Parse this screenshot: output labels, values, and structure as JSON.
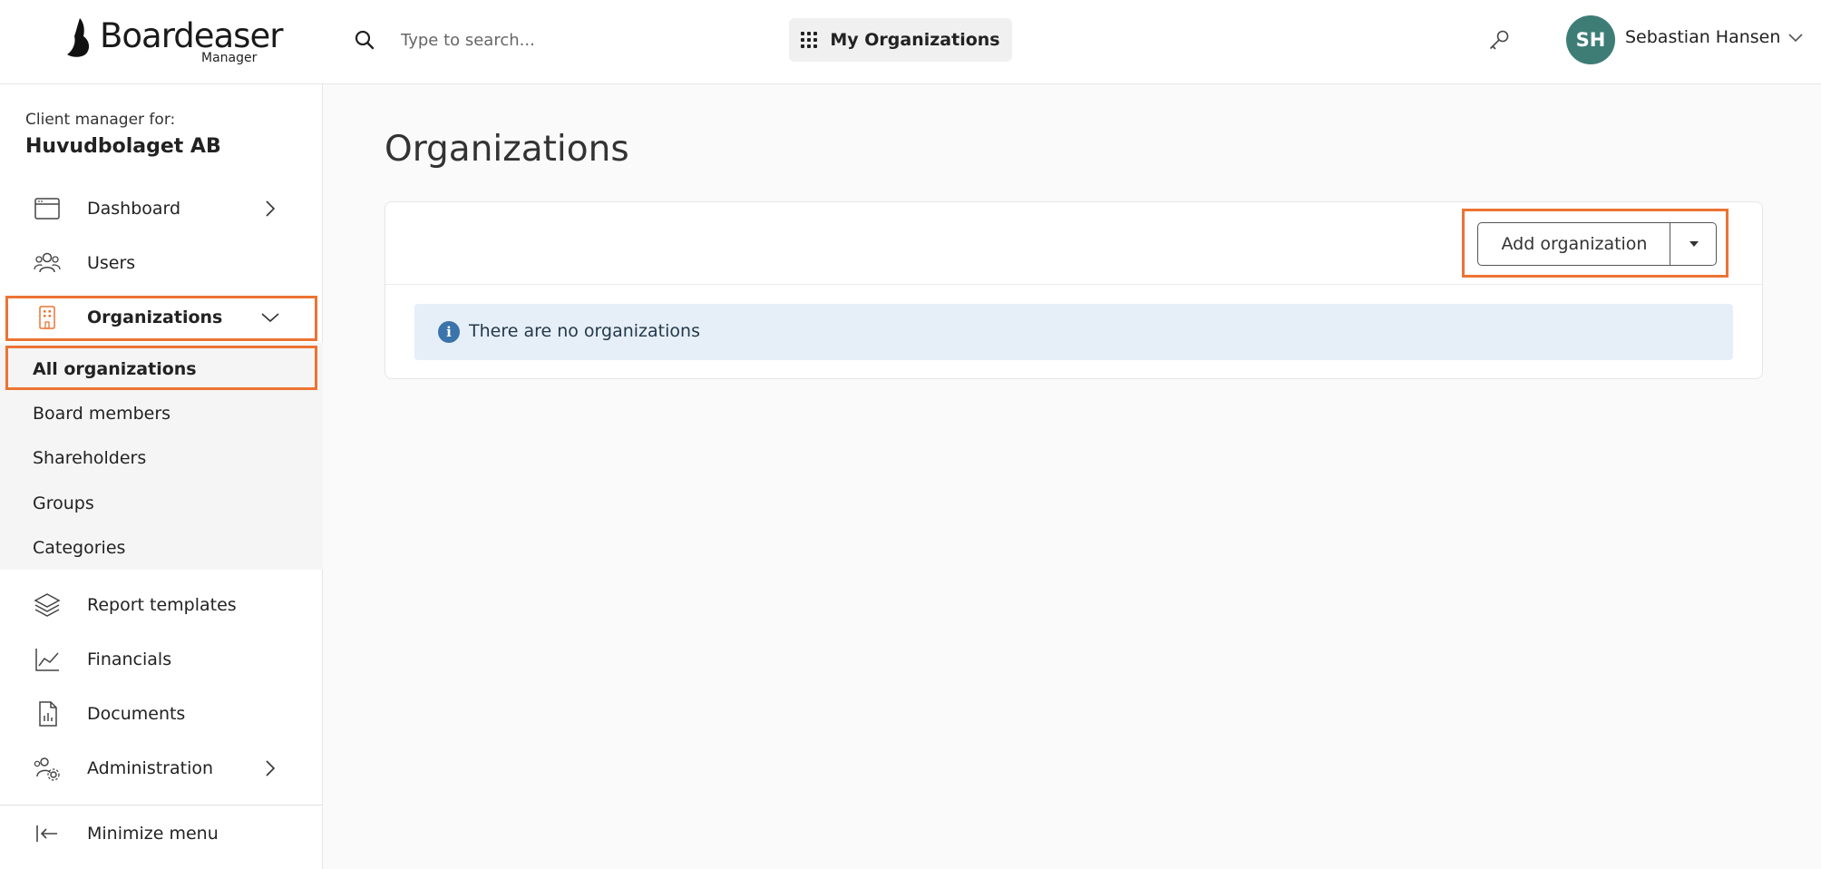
{
  "header": {
    "brand": "Boardeaser",
    "brand_sub": "Manager",
    "search_placeholder": "Type to search...",
    "org_switcher_label": "My Organizations",
    "user_initials": "SH",
    "user_name": "Sebastian Hansen",
    "avatar_color": "#3d7d76"
  },
  "sidebar": {
    "client_label": "Client manager for:",
    "client_name": "Huvudbolaget AB",
    "items": [
      {
        "label": "Dashboard",
        "icon": "browser-window-icon",
        "has_chevron": true
      },
      {
        "label": "Users",
        "icon": "users-icon"
      },
      {
        "label": "Organizations",
        "icon": "building-icon",
        "expanded": true,
        "active": true
      },
      {
        "label": "Report templates",
        "icon": "layers-icon"
      },
      {
        "label": "Financials",
        "icon": "line-chart-icon"
      },
      {
        "label": "Documents",
        "icon": "document-chart-icon"
      },
      {
        "label": "Administration",
        "icon": "users-gear-icon",
        "has_chevron": true
      }
    ],
    "sub_items": [
      {
        "label": "All organizations",
        "active": true
      },
      {
        "label": "Board members"
      },
      {
        "label": "Shareholders"
      },
      {
        "label": "Groups"
      },
      {
        "label": "Categories"
      }
    ],
    "minimize_label": "Minimize menu"
  },
  "main": {
    "title": "Organizations",
    "add_button_label": "Add organization",
    "empty_message": "There are no organizations"
  },
  "colors": {
    "highlight": "#ec7433",
    "alert_bg": "#e6eff7",
    "info_icon": "#3a74aa"
  }
}
